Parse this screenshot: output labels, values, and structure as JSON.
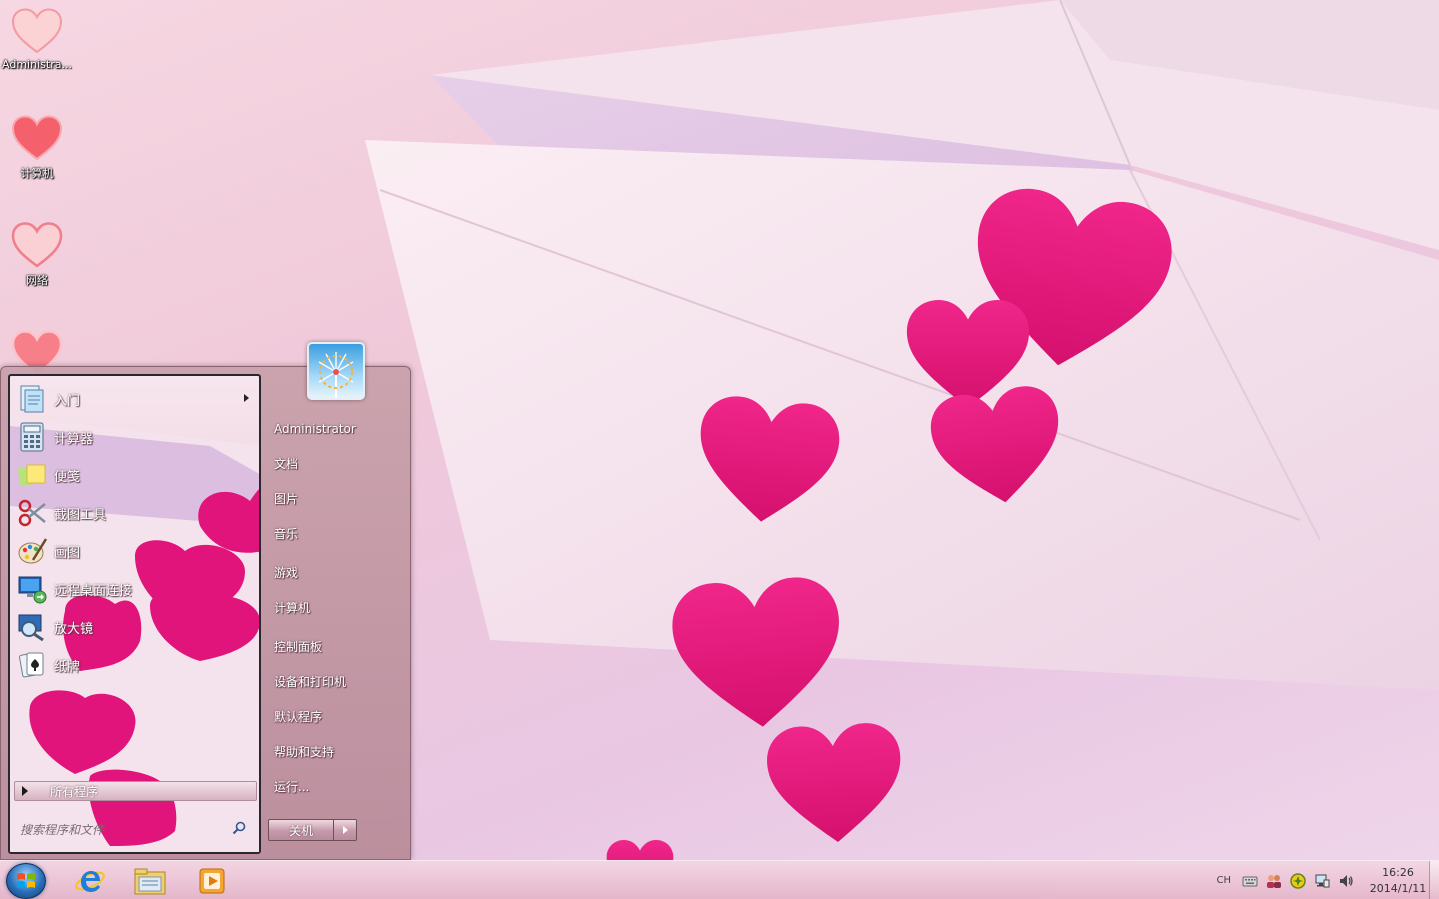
{
  "desktop": {
    "icons": [
      {
        "label": "Administra...",
        "icon": "heart-icon"
      },
      {
        "label": "计算机",
        "icon": "heart-icon"
      },
      {
        "label": "网络",
        "icon": "heart-icon"
      },
      {
        "label": "",
        "icon": "heart-icon"
      }
    ]
  },
  "start_menu": {
    "programs": [
      {
        "label": "入门",
        "icon": "getting-started-icon",
        "has_submenu": true
      },
      {
        "label": "计算器",
        "icon": "calculator-icon"
      },
      {
        "label": "便笺",
        "icon": "sticky-notes-icon"
      },
      {
        "label": "截图工具",
        "icon": "snipping-tool-icon"
      },
      {
        "label": "画图",
        "icon": "paint-icon"
      },
      {
        "label": "远程桌面连接",
        "icon": "remote-desktop-icon"
      },
      {
        "label": "放大镜",
        "icon": "magnifier-icon"
      },
      {
        "label": "纸牌",
        "icon": "solitaire-icon"
      }
    ],
    "all_programs_label": "所有程序",
    "search_placeholder": "搜索程序和文件",
    "right_pane": {
      "group1": [
        "Administrator",
        "文档",
        "图片",
        "音乐"
      ],
      "group2": [
        "游戏",
        "计算机"
      ],
      "group3": [
        "控制面板",
        "设备和打印机",
        "默认程序",
        "帮助和支持",
        "运行..."
      ]
    },
    "shutdown_label": "关机"
  },
  "taskbar": {
    "pinned": [
      {
        "name": "internet-explorer",
        "icon": "ie-icon"
      },
      {
        "name": "file-explorer",
        "icon": "folder-icon"
      },
      {
        "name": "media-player",
        "icon": "media-player-icon"
      }
    ],
    "language": "CH",
    "clock_time": "16:26",
    "clock_date": "2014/1/11"
  },
  "colors": {
    "heart": "#e2177a",
    "wallpaper_base": "#f3d2df",
    "taskbar": "#e9bfcf"
  }
}
